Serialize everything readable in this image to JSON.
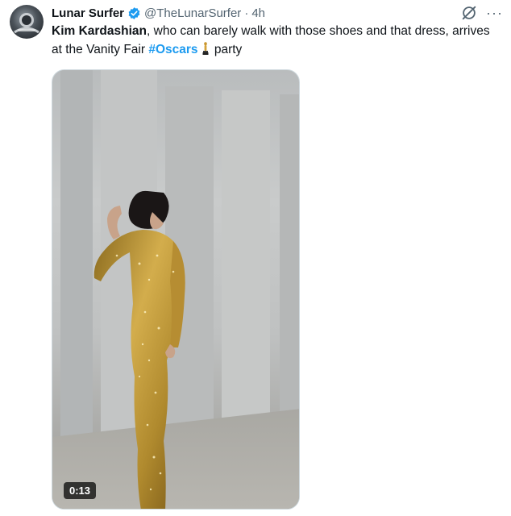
{
  "tweet": {
    "author_name": "Lunar Surfer",
    "handle": "@TheLunarSurfer",
    "separator": "·",
    "time": "4h",
    "text_bold": "Kim Kardashian",
    "text_part1": ", who can barely walk with those shoes and that dress, arrives at the Vanity Fair ",
    "hashtag": "#Oscars",
    "text_part2": " party",
    "more_label": "···"
  },
  "media": {
    "duration": "0:13"
  },
  "icons": {
    "verified": "verified-badge-icon",
    "grok": "grok-icon",
    "more": "more-icon",
    "oscar_emoji": "trophy-statuette-icon"
  },
  "colors": {
    "accent": "#1d9bf0",
    "text": "#0f1419",
    "muted": "#536471"
  }
}
